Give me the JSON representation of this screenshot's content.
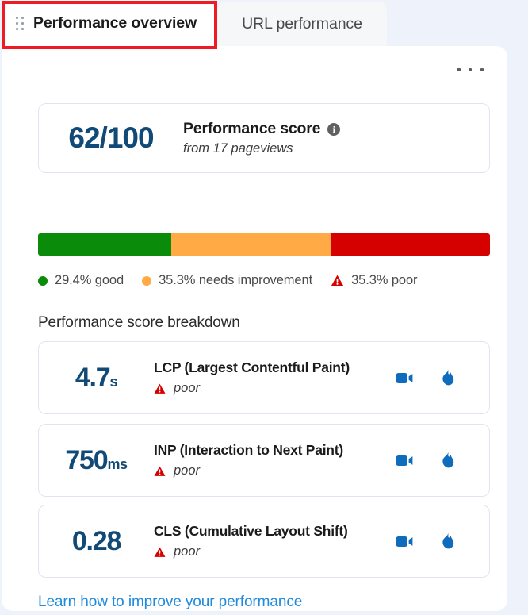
{
  "theme": {
    "accent_blue": "#0f6cbd",
    "link_blue": "#1f8bdd",
    "score_navy": "#114a76",
    "good_green": "#0a8b0a",
    "needs_improvement_orange": "#ffaa44",
    "poor_red": "#d50000",
    "selection_red": "#ee1b24",
    "page_background": "#eef3fb"
  },
  "tabs": [
    {
      "label": "Performance overview",
      "active": true
    },
    {
      "label": "URL performance",
      "active": false
    }
  ],
  "toolbar": {
    "overflow_label": "...",
    "drag_handle_label": "Drag to reorder"
  },
  "score_card": {
    "value": "62/100",
    "title": "Performance score",
    "info_glyph": "i",
    "subtitle": "from 17 pageviews"
  },
  "distribution": {
    "segments": [
      {
        "key": "good",
        "percent": 29.4,
        "label": "29.4% good"
      },
      {
        "key": "needs-improvement",
        "percent": 35.3,
        "label": "35.3% needs improvement"
      },
      {
        "key": "poor",
        "percent": 35.3,
        "label": "35.3% poor"
      }
    ]
  },
  "breakdown": {
    "heading": "Performance score breakdown",
    "metrics": [
      {
        "number": "4.7",
        "unit": "s",
        "name": "LCP (Largest Contentful Paint)",
        "rating": "poor",
        "actions": [
          "video-icon",
          "flame-icon"
        ]
      },
      {
        "number": "750",
        "unit": "ms",
        "name": "INP (Interaction to Next Paint)",
        "rating": "poor",
        "actions": [
          "video-icon",
          "flame-icon"
        ]
      },
      {
        "number": "0.28",
        "unit": "",
        "name": "CLS (Cumulative Layout Shift)",
        "rating": "poor",
        "actions": [
          "video-icon",
          "flame-icon"
        ]
      }
    ]
  },
  "footer": {
    "learn_link": "Learn how to improve your performance"
  }
}
